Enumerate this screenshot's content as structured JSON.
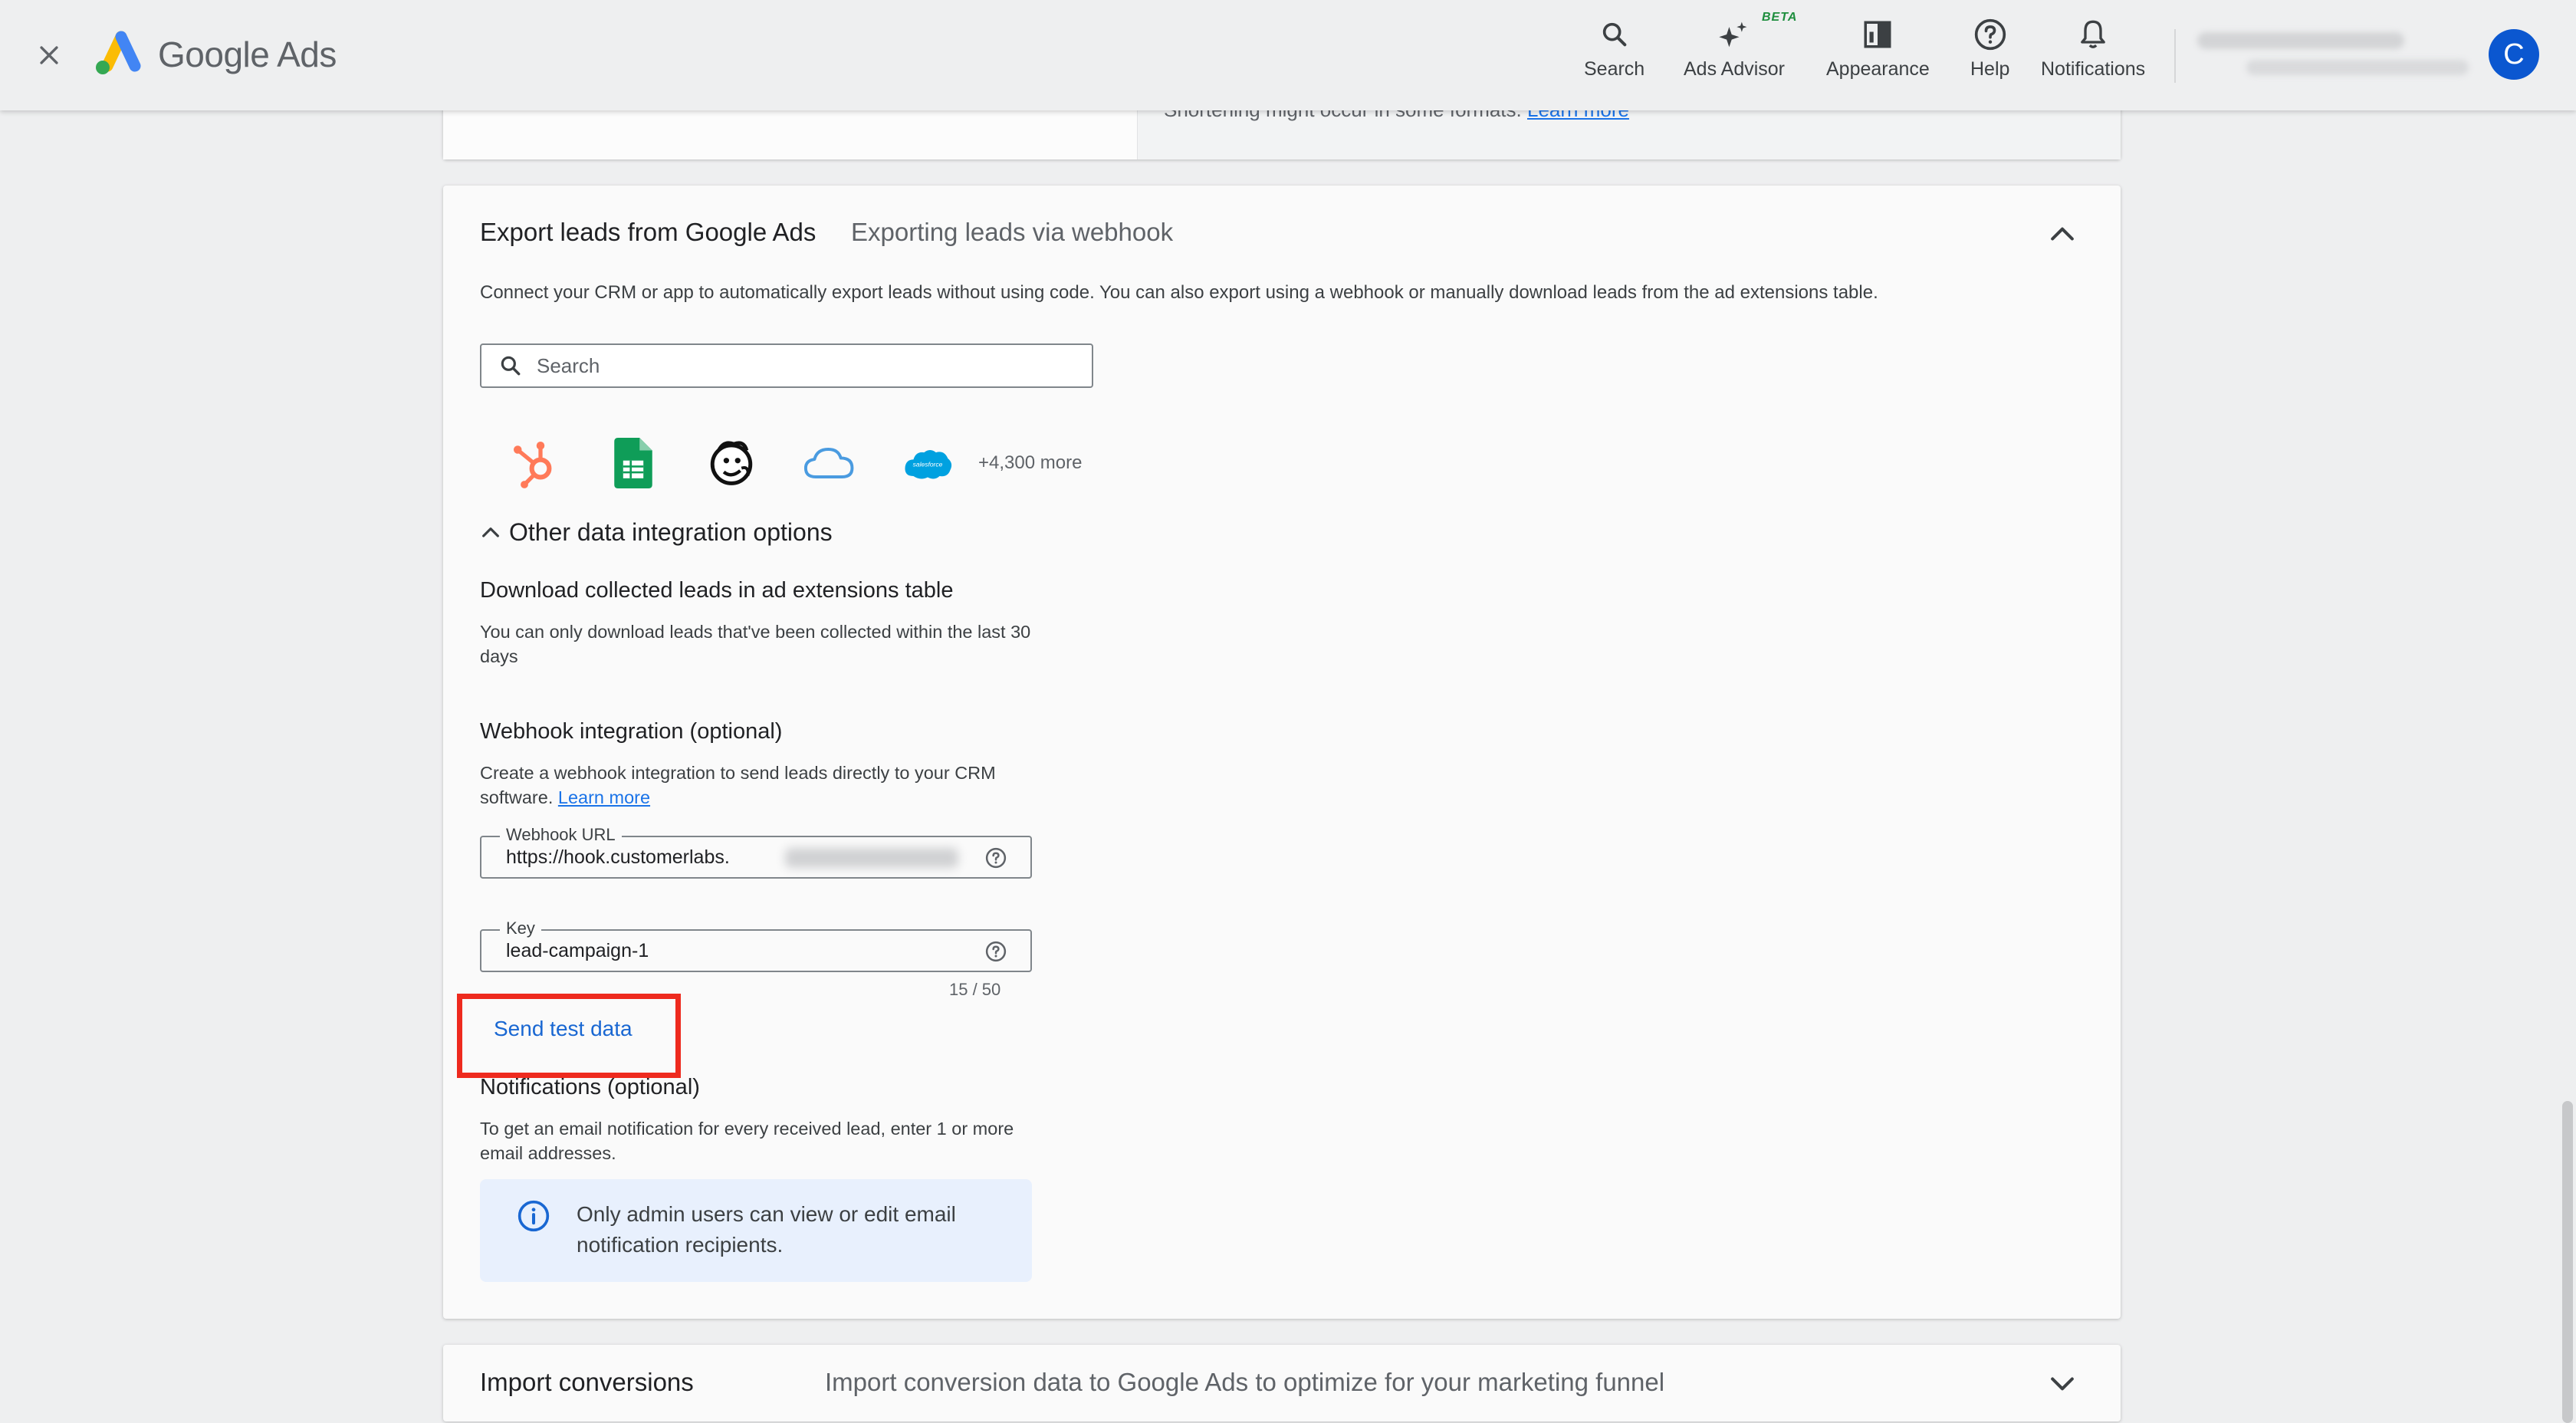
{
  "header": {
    "logo_text": "Google Ads",
    "nav": [
      {
        "label": "Search",
        "icon": "search-icon"
      },
      {
        "label": "Ads Advisor",
        "icon": "sparkle-icon",
        "badge": "BETA"
      },
      {
        "label": "Appearance",
        "icon": "appearance-icon"
      },
      {
        "label": "Help",
        "icon": "help-icon"
      },
      {
        "label": "Notifications",
        "icon": "bell-icon"
      }
    ],
    "avatar_letter": "C"
  },
  "top_card": {
    "text": "Shortening might occur in some formats.",
    "link": "Learn more"
  },
  "export": {
    "title": "Export leads from Google Ads",
    "subtitle": "Exporting leads via webhook",
    "description": "Connect your CRM or app to automatically export leads without using code. You can also export using a webhook or manually download leads from the ad extensions table.",
    "search_placeholder": "Search",
    "apps": [
      "hubspot-icon",
      "google-sheets-icon",
      "mailchimp-icon",
      "cloud-icon",
      "salesforce-icon"
    ],
    "salesforce_text": "salesforce",
    "more_apps": "+4,300 more",
    "other_options": "Other data integration options",
    "download": {
      "title": "Download collected leads in ad extensions table",
      "body": "You can only download leads that've been collected within the last 30 days"
    },
    "webhook": {
      "title": "Webhook integration (optional)",
      "body": "Create a webhook integration to send leads directly to your CRM software.",
      "link": "Learn more",
      "url_label": "Webhook URL",
      "url_value": "https://hook.customerlabs.",
      "key_label": "Key",
      "key_value": "lead-campaign-1",
      "counter": "15 / 50",
      "send_test": "Send test data"
    },
    "notifications": {
      "title": "Notifications (optional)",
      "body": "To get an email notification for every received lead, enter 1 or more email addresses.",
      "info": "Only admin users can view or edit email notification recipients."
    }
  },
  "import": {
    "title": "Import conversions",
    "subtitle": "Import conversion data to Google Ads to optimize for your marketing funnel"
  },
  "colors": {
    "accent": "#1a73e8",
    "highlight": "#ee2a1e",
    "avatar": "#0b57d0"
  }
}
